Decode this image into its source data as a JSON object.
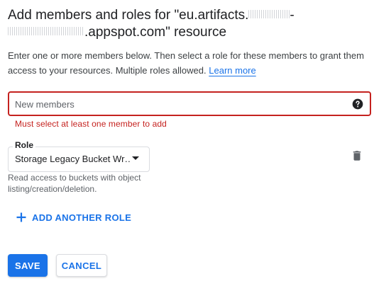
{
  "dialog": {
    "title_part1": "Add members and roles for \"eu.artifacts.",
    "title_part2": "-",
    "title_part3": ".appspot.com\" resource"
  },
  "description": {
    "text": "Enter one or more members below. Then select a role for these members to grant them access to your resources. Multiple roles allowed.",
    "learn_more": "Learn more"
  },
  "members": {
    "placeholder": "New members",
    "value": "",
    "error": "Must select at least one member to add",
    "help_icon": "help-circle-icon",
    "border_color": "#c5221f"
  },
  "role": {
    "label": "Role",
    "value": "Storage Legacy Bucket Wr…",
    "description": "Read access to buckets with object listing/creation/deletion.",
    "delete_icon": "trash-icon"
  },
  "add_role": {
    "label": "ADD ANOTHER ROLE",
    "icon": "plus-icon"
  },
  "actions": {
    "save_label": "SAVE",
    "cancel_label": "CANCEL"
  },
  "colors": {
    "accent": "#1a73e8",
    "error": "#c5221f",
    "text": "#202124"
  }
}
